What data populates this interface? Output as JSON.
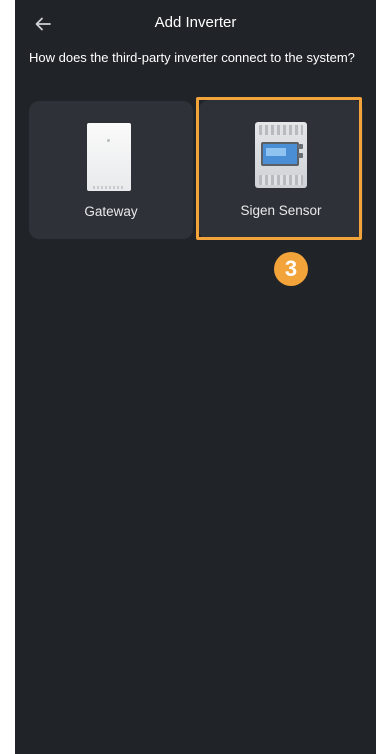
{
  "header": {
    "back_icon": "arrow-left-icon",
    "title": "Add Inverter"
  },
  "question": "How does the third-party inverter connect to the system?",
  "options": [
    {
      "label": "Gateway",
      "icon": "gateway-device-icon",
      "selected": false
    },
    {
      "label": "Sigen Sensor",
      "icon": "sigen-sensor-device-icon",
      "selected": true
    }
  ],
  "annotation": {
    "step": "3"
  },
  "colors": {
    "background": "#202328",
    "card": "#2e3138",
    "highlight": "#f2a43a",
    "text": "#ffffff"
  }
}
